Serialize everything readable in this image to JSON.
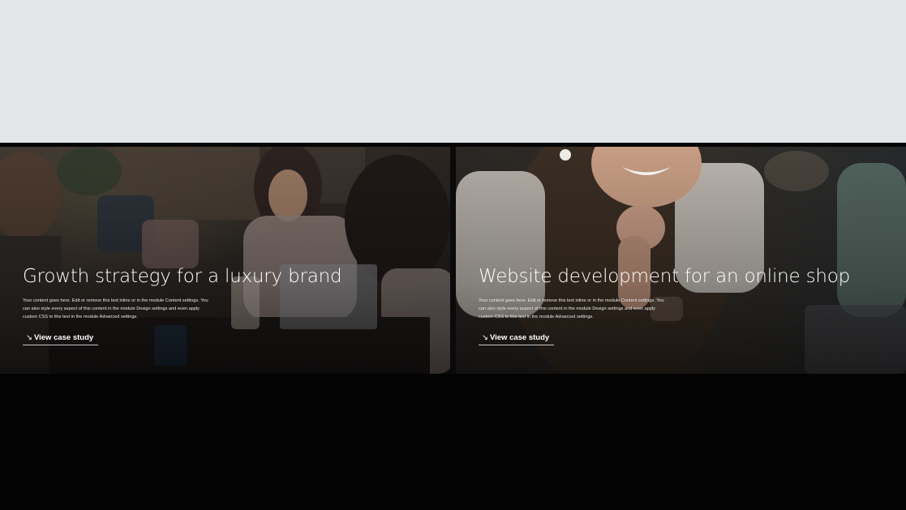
{
  "cases": [
    {
      "title": "Growth strategy for a luxury brand",
      "body": "Your content goes here. Edit or remove this text inline or in the module Content settings. You can also style every aspect of this content in the module Design settings and even apply custom CSS to this text in the module Advanced settings.",
      "cta_label": "View case study",
      "cta_icon": "arrow-down-right-icon"
    },
    {
      "title": "Website development for an online shop",
      "body": "Your content goes here. Edit or remove this text inline or in the module Content settings. You can also style every aspect of this content in the module Design settings and even apply custom CSS to this text in the module Advanced settings.",
      "cta_label": "View case study",
      "cta_icon": "arrow-down-right-icon"
    }
  ],
  "colors": {
    "top_band": "#e5e6ea",
    "background": "#030303",
    "text": "#ffffff"
  }
}
